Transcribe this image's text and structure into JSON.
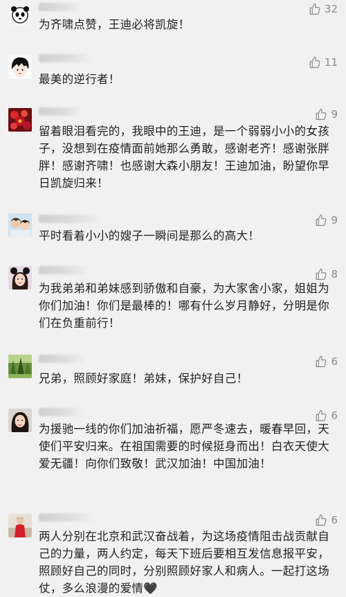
{
  "comments": [
    {
      "likes": "32",
      "text": "为齐啸点赞，王迪必将凯旋！",
      "avatar": "panda"
    },
    {
      "likes": "11",
      "text": "最美的逆行者！",
      "avatar": "anime-boy"
    },
    {
      "likes": "9",
      "text": "留着眼泪看完的，我眼中的王迪，是一个弱弱小小的女孩子，没想到在疫情面前她那么勇敢，感谢老齐！感谢张胖胖！感谢齐啸！也感谢大森小朋友！王迪加油，盼望你早日凯旋归来！",
      "avatar": "red-flowers"
    },
    {
      "likes": "9",
      "text": "平时看着小小的嫂子一瞬间是那么的高大！",
      "avatar": "kids"
    },
    {
      "likes": "8",
      "text": "为我弟弟和弟妹感到骄傲和自豪，为大家舍小家，姐姐为你们加油！你们是最棒的！哪有什么岁月静好，分明是你们在负重前行！",
      "avatar": "girl-ears"
    },
    {
      "likes": "6",
      "text": "兄弟，照顾好家庭！弟妹，保护好自己！",
      "avatar": "forest"
    },
    {
      "likes": "6",
      "text": "为援驰一线的你们加油祈福，愿严冬速去，暖春早回，天使们平安归来。在祖国需要的时候挺身而出！白衣天使大爱无疆！向你们致敬！武汉加油！中国加油！",
      "avatar": "woman-portrait"
    },
    {
      "likes": "6",
      "text": "两人分别在北京和武汉奋战着，为这场疫情阻击战贡献自己的力量，两人约定，每天下班后要相互发信息报平安，照顾好自己的同时，分别照顾好家人和病人。一起打这场仗，多么浪漫的爱情🖤",
      "avatar": "red-figure"
    }
  ]
}
